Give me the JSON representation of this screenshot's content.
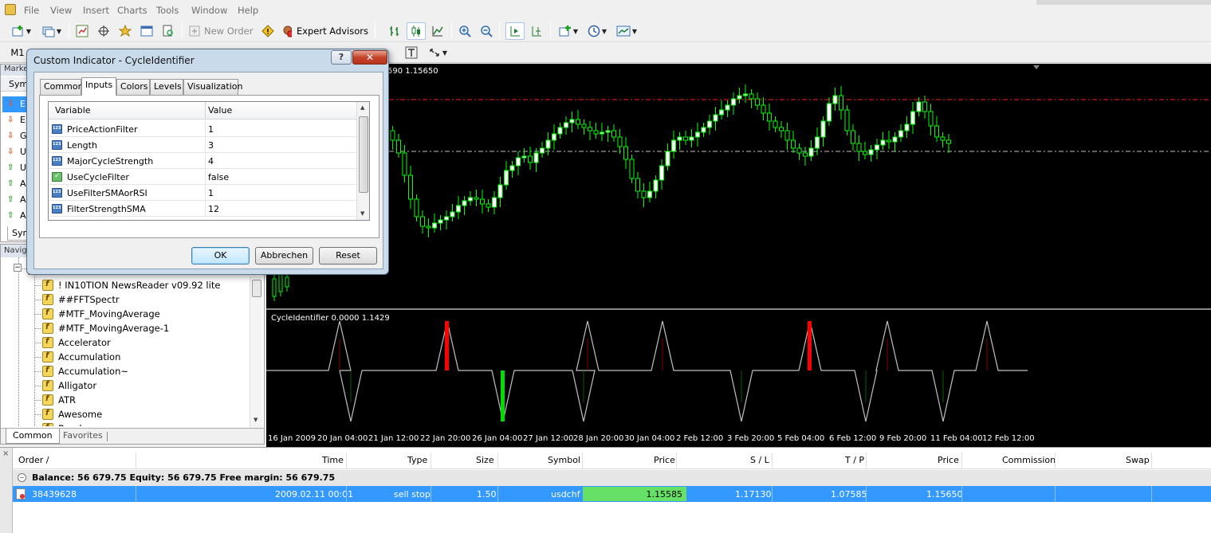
{
  "menu": [
    "File",
    "View",
    "Insert",
    "Charts",
    "Tools",
    "Window",
    "Help"
  ],
  "toolbar": {
    "new_order": "New Order",
    "expert_advisors": "Expert Advisors",
    "timeframe": "M1"
  },
  "market_watch": {
    "header": "Marke",
    "col_symbol": "Symb",
    "rows": [
      {
        "symbol": "E",
        "dir": "down"
      },
      {
        "symbol": "E",
        "dir": "down"
      },
      {
        "symbol": "G",
        "dir": "down"
      },
      {
        "symbol": "U",
        "dir": "down"
      },
      {
        "symbol": "U",
        "dir": "up"
      },
      {
        "symbol": "A",
        "dir": "up"
      },
      {
        "symbol": "A",
        "dir": "up"
      },
      {
        "symbol": "A",
        "dir": "up"
      }
    ],
    "tab": "Sym"
  },
  "navigator": {
    "header": "Navig",
    "items": [
      "! IN10TION NewsReader v09.92 lite",
      "##FFTSpectr",
      "#MTF_MovingAverage",
      "#MTF_MovingAverage-1",
      "Accelerator",
      "Accumulation",
      "Accumulation~",
      "Alligator",
      "ATR",
      "Awesome",
      "Bands"
    ],
    "tabs": {
      "common": "Common",
      "favorites": "Favorites"
    }
  },
  "chart": {
    "main_label": "590 1.15650",
    "sub_label": "CycleIdentifier 0.0000 1.1429",
    "time_ticks": [
      "16 Jan 2009",
      "20 Jan 04:00",
      "21 Jan 12:00",
      "22 Jan 20:00",
      "26 Jan 04:00",
      "27 Jan 12:00",
      "28 Jan 20:00",
      "30 Jan 04:00",
      "2 Feb 12:00",
      "3 Feb 20:00",
      "5 Feb 04:00",
      "6 Feb 12:00",
      "9 Feb 20:00",
      "11 Feb 04:00",
      "12 Feb 12:00"
    ],
    "colors": {
      "up": "#00ff00",
      "down": "#00ff00",
      "sl_line": "#ff2020",
      "price_line": "#c0c0c0",
      "cycle_line": "#c0c0c0",
      "cycle_red": "#ff0000",
      "cycle_green": "#00dd00"
    }
  },
  "dialog": {
    "title": "Custom Indicator - CycleIdentifier",
    "help": "?",
    "close": "✕",
    "tabs": [
      "Common",
      "Inputs",
      "Colors",
      "Levels",
      "Visualization"
    ],
    "active_tab": "Inputs",
    "grid_headers": {
      "variable": "Variable",
      "value": "Value"
    },
    "inputs": [
      {
        "name": "PriceActionFilter",
        "value": "1",
        "type": "int"
      },
      {
        "name": "Length",
        "value": "3",
        "type": "int"
      },
      {
        "name": "MajorCycleStrength",
        "value": "4",
        "type": "int"
      },
      {
        "name": "UseCycleFilter",
        "value": "false",
        "type": "bool"
      },
      {
        "name": "UseFilterSMAorRSI",
        "value": "1",
        "type": "int"
      },
      {
        "name": "FilterStrengthSMA",
        "value": "12",
        "type": "int"
      }
    ],
    "buttons": {
      "ok": "OK",
      "cancel": "Abbrechen",
      "reset": "Reset"
    }
  },
  "terminal": {
    "columns": {
      "order": "Order /",
      "time": "Time",
      "type": "Type",
      "size": "Size",
      "symbol": "Symbol",
      "price": "Price",
      "sl": "S / L",
      "tp": "T / P",
      "price2": "Price",
      "commission": "Commission",
      "swap": "Swap"
    },
    "balance_text": "Balance: 56 679.75  Equity: 56 679.75  Free margin: 56 679.75",
    "order": {
      "order": "38439628",
      "time": "2009.02.11 00:01",
      "type": "sell stop",
      "size": "1.50",
      "symbol": "usdchf",
      "price": "1.15585",
      "sl": "1.17130",
      "tp": "1.07585",
      "price2": "1.15650"
    },
    "close_icon": "×"
  }
}
